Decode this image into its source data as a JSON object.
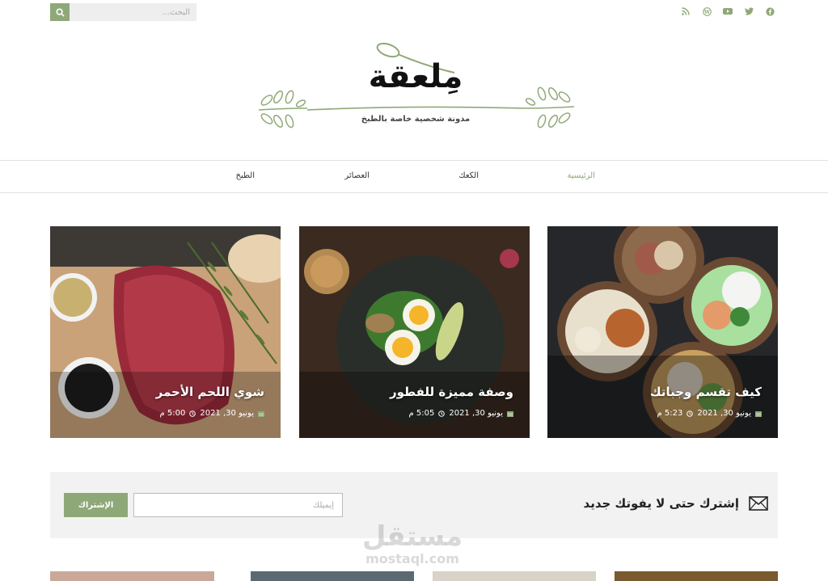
{
  "search": {
    "placeholder": "البحث..."
  },
  "social": [
    "facebook-icon",
    "twitter-icon",
    "youtube-icon",
    "wordpress-icon",
    "rss-icon"
  ],
  "logo": {
    "title": "مِلعقة",
    "tagline": "مدونة شخصية خاصة بالطبخ"
  },
  "nav": {
    "home": "الرئيسية",
    "cakes": "الكعك",
    "juices": "العصائر",
    "cooking": "الطبخ"
  },
  "posts": [
    {
      "title": "كيف تقسم وجباتك",
      "date": "يونيو 30, 2021",
      "time": "5:23 م"
    },
    {
      "title": "وصفة مميزة للفطور",
      "date": "يونيو 30, 2021",
      "time": "5:05 م"
    },
    {
      "title": "شوي اللحم الأحمر",
      "date": "يونيو 30, 2021",
      "time": "5:00 م"
    }
  ],
  "subscribe": {
    "heading": "إشترك حتى لا يفوتك جديد",
    "email_placeholder": "إيميلك",
    "button": "الإشتراك"
  },
  "watermark": {
    "ar": "مستقل",
    "en": "mostaql.com"
  },
  "colors": {
    "accent": "#8fa878",
    "panel": "#f2f2f2"
  }
}
